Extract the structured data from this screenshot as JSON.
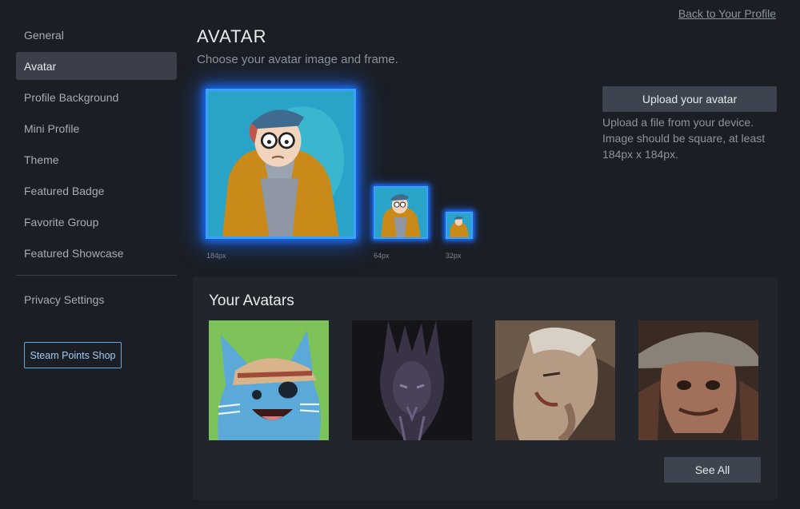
{
  "header": {
    "back_link": "Back to Your Profile",
    "title": "AVATAR",
    "subtitle": "Choose your avatar image and frame."
  },
  "sidebar": {
    "items": [
      {
        "label": "General",
        "active": false
      },
      {
        "label": "Avatar",
        "active": true
      },
      {
        "label": "Profile Background",
        "active": false
      },
      {
        "label": "Mini Profile",
        "active": false
      },
      {
        "label": "Theme",
        "active": false
      },
      {
        "label": "Featured Badge",
        "active": false
      },
      {
        "label": "Favorite Group",
        "active": false
      },
      {
        "label": "Featured Showcase",
        "active": false
      }
    ],
    "privacy_label": "Privacy Settings",
    "points_shop_label": "Steam Points Shop"
  },
  "preview": {
    "sizes": [
      "184px",
      "64px",
      "32px"
    ],
    "frame_color": "#3aa0ff"
  },
  "upload": {
    "button_label": "Upload your avatar",
    "help_text": "Upload a file from your device. Image should be square, at least 184px x 184px."
  },
  "your_avatars": {
    "title": "Your Avatars",
    "see_all_label": "See All",
    "thumbnails": [
      {
        "icon": "pirate-cat-avatar"
      },
      {
        "icon": "dark-horned-figure-avatar"
      },
      {
        "icon": "painted-face-avatar"
      },
      {
        "icon": "hat-man-avatar"
      }
    ]
  },
  "colors": {
    "background": "#1b1e25",
    "accent_blue": "#66a9dd",
    "button_bg": "#3d4450",
    "active_nav": "#3a3f4a"
  }
}
